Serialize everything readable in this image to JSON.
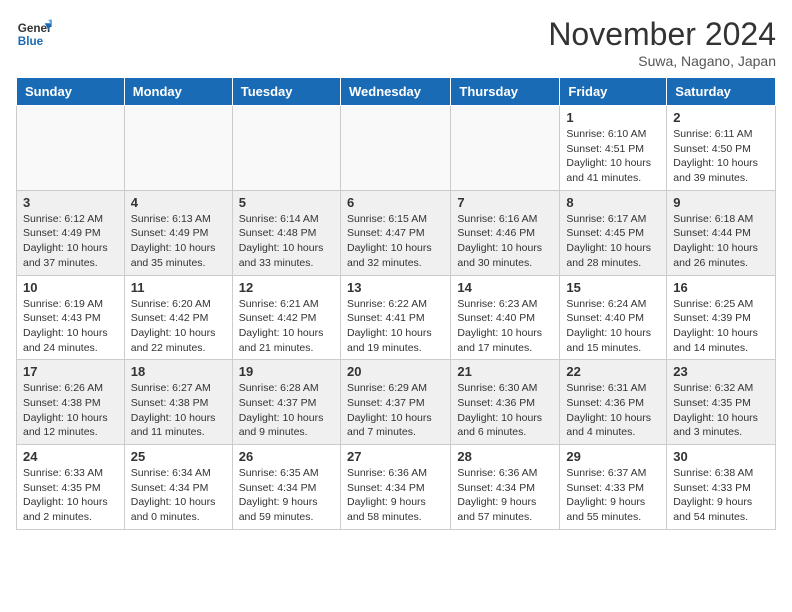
{
  "header": {
    "logo_line1": "General",
    "logo_line2": "Blue",
    "month": "November 2024",
    "location": "Suwa, Nagano, Japan"
  },
  "days_of_week": [
    "Sunday",
    "Monday",
    "Tuesday",
    "Wednesday",
    "Thursday",
    "Friday",
    "Saturday"
  ],
  "weeks": [
    [
      {
        "day": "",
        "info": ""
      },
      {
        "day": "",
        "info": ""
      },
      {
        "day": "",
        "info": ""
      },
      {
        "day": "",
        "info": ""
      },
      {
        "day": "",
        "info": ""
      },
      {
        "day": "1",
        "info": "Sunrise: 6:10 AM\nSunset: 4:51 PM\nDaylight: 10 hours and 41 minutes."
      },
      {
        "day": "2",
        "info": "Sunrise: 6:11 AM\nSunset: 4:50 PM\nDaylight: 10 hours and 39 minutes."
      }
    ],
    [
      {
        "day": "3",
        "info": "Sunrise: 6:12 AM\nSunset: 4:49 PM\nDaylight: 10 hours and 37 minutes."
      },
      {
        "day": "4",
        "info": "Sunrise: 6:13 AM\nSunset: 4:49 PM\nDaylight: 10 hours and 35 minutes."
      },
      {
        "day": "5",
        "info": "Sunrise: 6:14 AM\nSunset: 4:48 PM\nDaylight: 10 hours and 33 minutes."
      },
      {
        "day": "6",
        "info": "Sunrise: 6:15 AM\nSunset: 4:47 PM\nDaylight: 10 hours and 32 minutes."
      },
      {
        "day": "7",
        "info": "Sunrise: 6:16 AM\nSunset: 4:46 PM\nDaylight: 10 hours and 30 minutes."
      },
      {
        "day": "8",
        "info": "Sunrise: 6:17 AM\nSunset: 4:45 PM\nDaylight: 10 hours and 28 minutes."
      },
      {
        "day": "9",
        "info": "Sunrise: 6:18 AM\nSunset: 4:44 PM\nDaylight: 10 hours and 26 minutes."
      }
    ],
    [
      {
        "day": "10",
        "info": "Sunrise: 6:19 AM\nSunset: 4:43 PM\nDaylight: 10 hours and 24 minutes."
      },
      {
        "day": "11",
        "info": "Sunrise: 6:20 AM\nSunset: 4:42 PM\nDaylight: 10 hours and 22 minutes."
      },
      {
        "day": "12",
        "info": "Sunrise: 6:21 AM\nSunset: 4:42 PM\nDaylight: 10 hours and 21 minutes."
      },
      {
        "day": "13",
        "info": "Sunrise: 6:22 AM\nSunset: 4:41 PM\nDaylight: 10 hours and 19 minutes."
      },
      {
        "day": "14",
        "info": "Sunrise: 6:23 AM\nSunset: 4:40 PM\nDaylight: 10 hours and 17 minutes."
      },
      {
        "day": "15",
        "info": "Sunrise: 6:24 AM\nSunset: 4:40 PM\nDaylight: 10 hours and 15 minutes."
      },
      {
        "day": "16",
        "info": "Sunrise: 6:25 AM\nSunset: 4:39 PM\nDaylight: 10 hours and 14 minutes."
      }
    ],
    [
      {
        "day": "17",
        "info": "Sunrise: 6:26 AM\nSunset: 4:38 PM\nDaylight: 10 hours and 12 minutes."
      },
      {
        "day": "18",
        "info": "Sunrise: 6:27 AM\nSunset: 4:38 PM\nDaylight: 10 hours and 11 minutes."
      },
      {
        "day": "19",
        "info": "Sunrise: 6:28 AM\nSunset: 4:37 PM\nDaylight: 10 hours and 9 minutes."
      },
      {
        "day": "20",
        "info": "Sunrise: 6:29 AM\nSunset: 4:37 PM\nDaylight: 10 hours and 7 minutes."
      },
      {
        "day": "21",
        "info": "Sunrise: 6:30 AM\nSunset: 4:36 PM\nDaylight: 10 hours and 6 minutes."
      },
      {
        "day": "22",
        "info": "Sunrise: 6:31 AM\nSunset: 4:36 PM\nDaylight: 10 hours and 4 minutes."
      },
      {
        "day": "23",
        "info": "Sunrise: 6:32 AM\nSunset: 4:35 PM\nDaylight: 10 hours and 3 minutes."
      }
    ],
    [
      {
        "day": "24",
        "info": "Sunrise: 6:33 AM\nSunset: 4:35 PM\nDaylight: 10 hours and 2 minutes."
      },
      {
        "day": "25",
        "info": "Sunrise: 6:34 AM\nSunset: 4:34 PM\nDaylight: 10 hours and 0 minutes."
      },
      {
        "day": "26",
        "info": "Sunrise: 6:35 AM\nSunset: 4:34 PM\nDaylight: 9 hours and 59 minutes."
      },
      {
        "day": "27",
        "info": "Sunrise: 6:36 AM\nSunset: 4:34 PM\nDaylight: 9 hours and 58 minutes."
      },
      {
        "day": "28",
        "info": "Sunrise: 6:36 AM\nSunset: 4:34 PM\nDaylight: 9 hours and 57 minutes."
      },
      {
        "day": "29",
        "info": "Sunrise: 6:37 AM\nSunset: 4:33 PM\nDaylight: 9 hours and 55 minutes."
      },
      {
        "day": "30",
        "info": "Sunrise: 6:38 AM\nSunset: 4:33 PM\nDaylight: 9 hours and 54 minutes."
      }
    ]
  ]
}
